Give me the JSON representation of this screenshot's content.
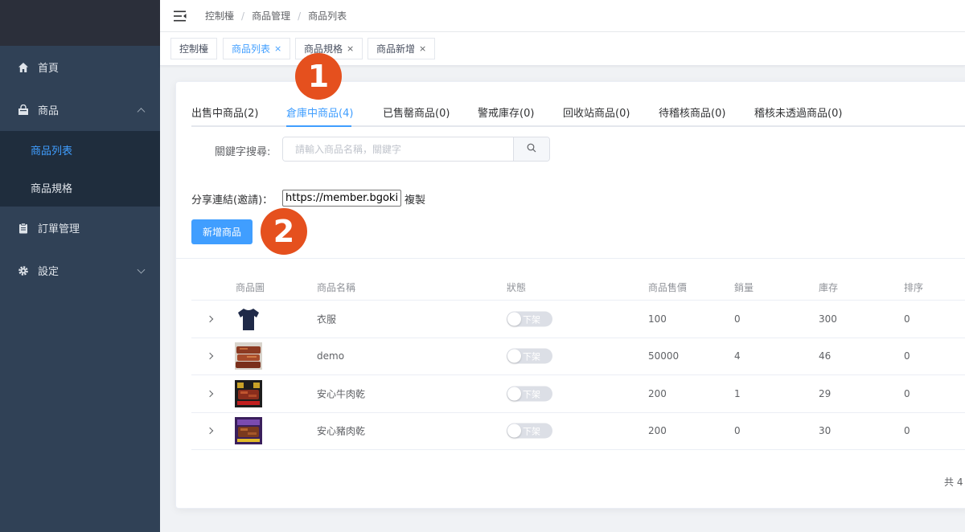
{
  "sidebar": {
    "items": [
      {
        "label": "首頁",
        "icon": "home-icon"
      },
      {
        "label": "商品",
        "icon": "shopping-bag-icon",
        "expanded": true
      },
      {
        "label": "訂單管理",
        "icon": "clipboard-icon"
      },
      {
        "label": "設定",
        "icon": "gear-icon",
        "expanded": false
      }
    ],
    "product_submenu": [
      {
        "label": "商品列表",
        "active": true
      },
      {
        "label": "商品規格",
        "active": false
      }
    ]
  },
  "navbar": {
    "breadcrumb": [
      "控制檯",
      "商品管理",
      "商品列表"
    ],
    "separator": "/"
  },
  "tagsview": {
    "tags": [
      {
        "label": "控制檯",
        "closable": false,
        "active": false
      },
      {
        "label": "商品列表",
        "closable": true,
        "active": true
      },
      {
        "label": "商品規格",
        "closable": true,
        "active": false
      },
      {
        "label": "商品新增",
        "closable": true,
        "active": false
      }
    ],
    "close_glyph": "×"
  },
  "tabs": [
    {
      "label": "出售中商品(2)"
    },
    {
      "label": "倉庫中商品(4)",
      "active": true
    },
    {
      "label": "已售罄商品(0)"
    },
    {
      "label": "警戒庫存(0)"
    },
    {
      "label": "回收站商品(0)"
    },
    {
      "label": "待稽核商品(0)"
    },
    {
      "label": "稽核未透過商品(0)"
    }
  ],
  "search": {
    "label": "關鍵字搜尋:",
    "placeholder": "請輸入商品名稱，關鍵字"
  },
  "share": {
    "label": "分享連結(邀請)：",
    "value": "https://member.bgokin",
    "copy_label": "複製"
  },
  "add_button": "新增商品",
  "table": {
    "headers": [
      "商品圖",
      "商品名稱",
      "狀態",
      "商品售價",
      "銷量",
      "庫存",
      "排序"
    ],
    "rows": [
      {
        "name": "衣服",
        "status": "下架",
        "price": "100",
        "sales": "0",
        "stock": "300",
        "sort": "0",
        "thumb": "tshirt"
      },
      {
        "name": "demo",
        "status": "下架",
        "price": "50000",
        "sales": "4",
        "stock": "46",
        "sort": "0",
        "thumb": "meat"
      },
      {
        "name": "安心牛肉乾",
        "status": "下架",
        "price": "200",
        "sales": "1",
        "stock": "29",
        "sort": "0",
        "thumb": "beef-pack"
      },
      {
        "name": "安心豬肉乾",
        "status": "下架",
        "price": "200",
        "sales": "0",
        "stock": "30",
        "sort": "0",
        "thumb": "pork-pack"
      }
    ]
  },
  "pagination": {
    "total_text": "共 4"
  },
  "badges": {
    "one": "1",
    "two": "2",
    "color": "#e5501e"
  },
  "colors": {
    "accent": "#409eff",
    "sidebar_bg": "#304156",
    "submenu_bg": "#1f2d3d"
  }
}
